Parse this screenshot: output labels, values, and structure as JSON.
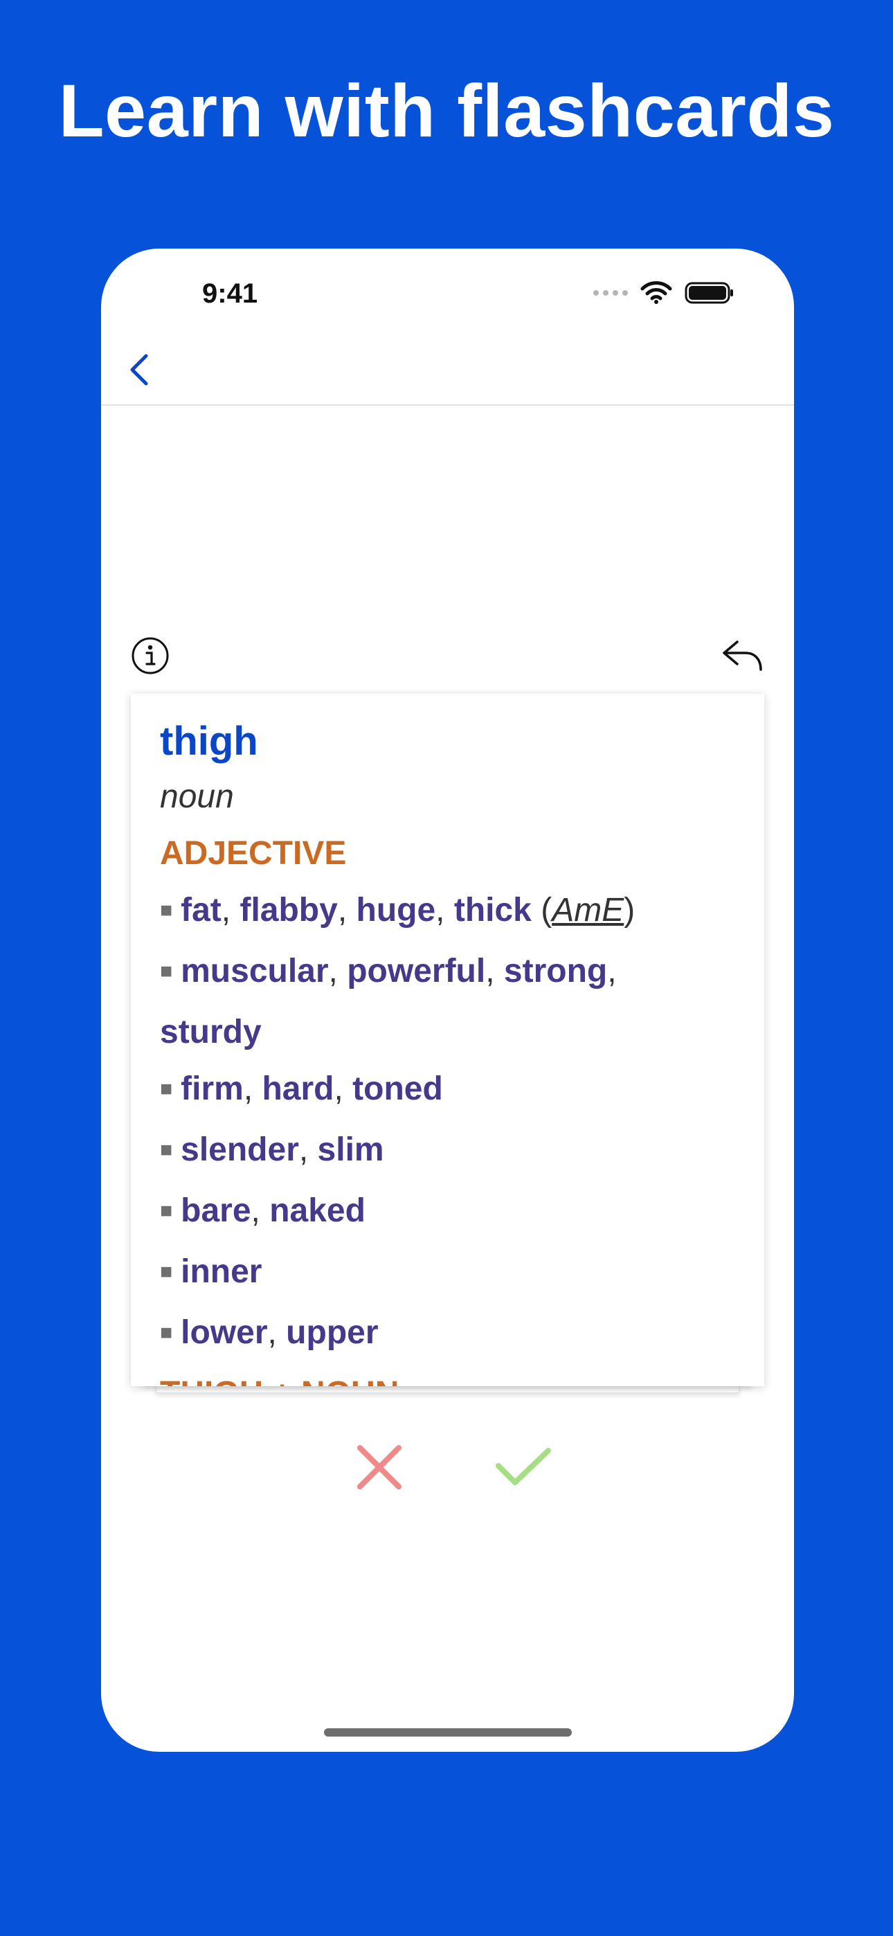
{
  "headline": "Learn with flashcards",
  "status_bar": {
    "time": "9:41"
  },
  "card": {
    "headword": "thigh",
    "part_of_speech": "noun",
    "sections": [
      {
        "heading": "ADJECTIVE",
        "lines": [
          {
            "words": [
              "fat",
              "flabby",
              "huge",
              "thick"
            ],
            "register": "AmE"
          },
          {
            "words": [
              "muscular",
              "powerful",
              "strong,"
            ]
          },
          {
            "words": [
              "sturdy"
            ],
            "continuation": true
          },
          {
            "words": [
              "firm",
              "hard",
              "toned"
            ]
          },
          {
            "words": [
              "slender",
              "slim"
            ]
          },
          {
            "words": [
              "bare",
              "naked"
            ]
          },
          {
            "words": [
              "inner"
            ]
          },
          {
            "words": [
              "lower",
              "upper"
            ]
          }
        ]
      },
      {
        "heading": "THIGH + NOUN",
        "lines": []
      }
    ]
  },
  "line_texts": {
    "l0": {
      "w0": "fat",
      "w1": "flabby",
      "w2": "huge",
      "w3": "thick",
      "reg": "AmE"
    },
    "l1": {
      "w0": "muscular",
      "w1": "powerful",
      "w2": "strong"
    },
    "l2": {
      "w0": "sturdy"
    },
    "l3": {
      "w0": "firm",
      "w1": "hard",
      "w2": "toned"
    },
    "l4": {
      "w0": "slender",
      "w1": "slim"
    },
    "l5": {
      "w0": "bare",
      "w1": "naked"
    },
    "l6": {
      "w0": "inner"
    },
    "l7": {
      "w0": "lower",
      "w1": "upper"
    }
  },
  "icons": {
    "back": "chevron-left-icon",
    "info": "info-circle-icon",
    "flip": "reply-arrow-icon",
    "wrong": "x-mark-icon",
    "right": "checkmark-icon"
  },
  "colors": {
    "background": "#0652D9",
    "headword": "#0B46C8",
    "section_heading": "#CC6A22",
    "collocate": "#44398A",
    "wrong": "#F08A8A",
    "right": "#A6DE84"
  }
}
